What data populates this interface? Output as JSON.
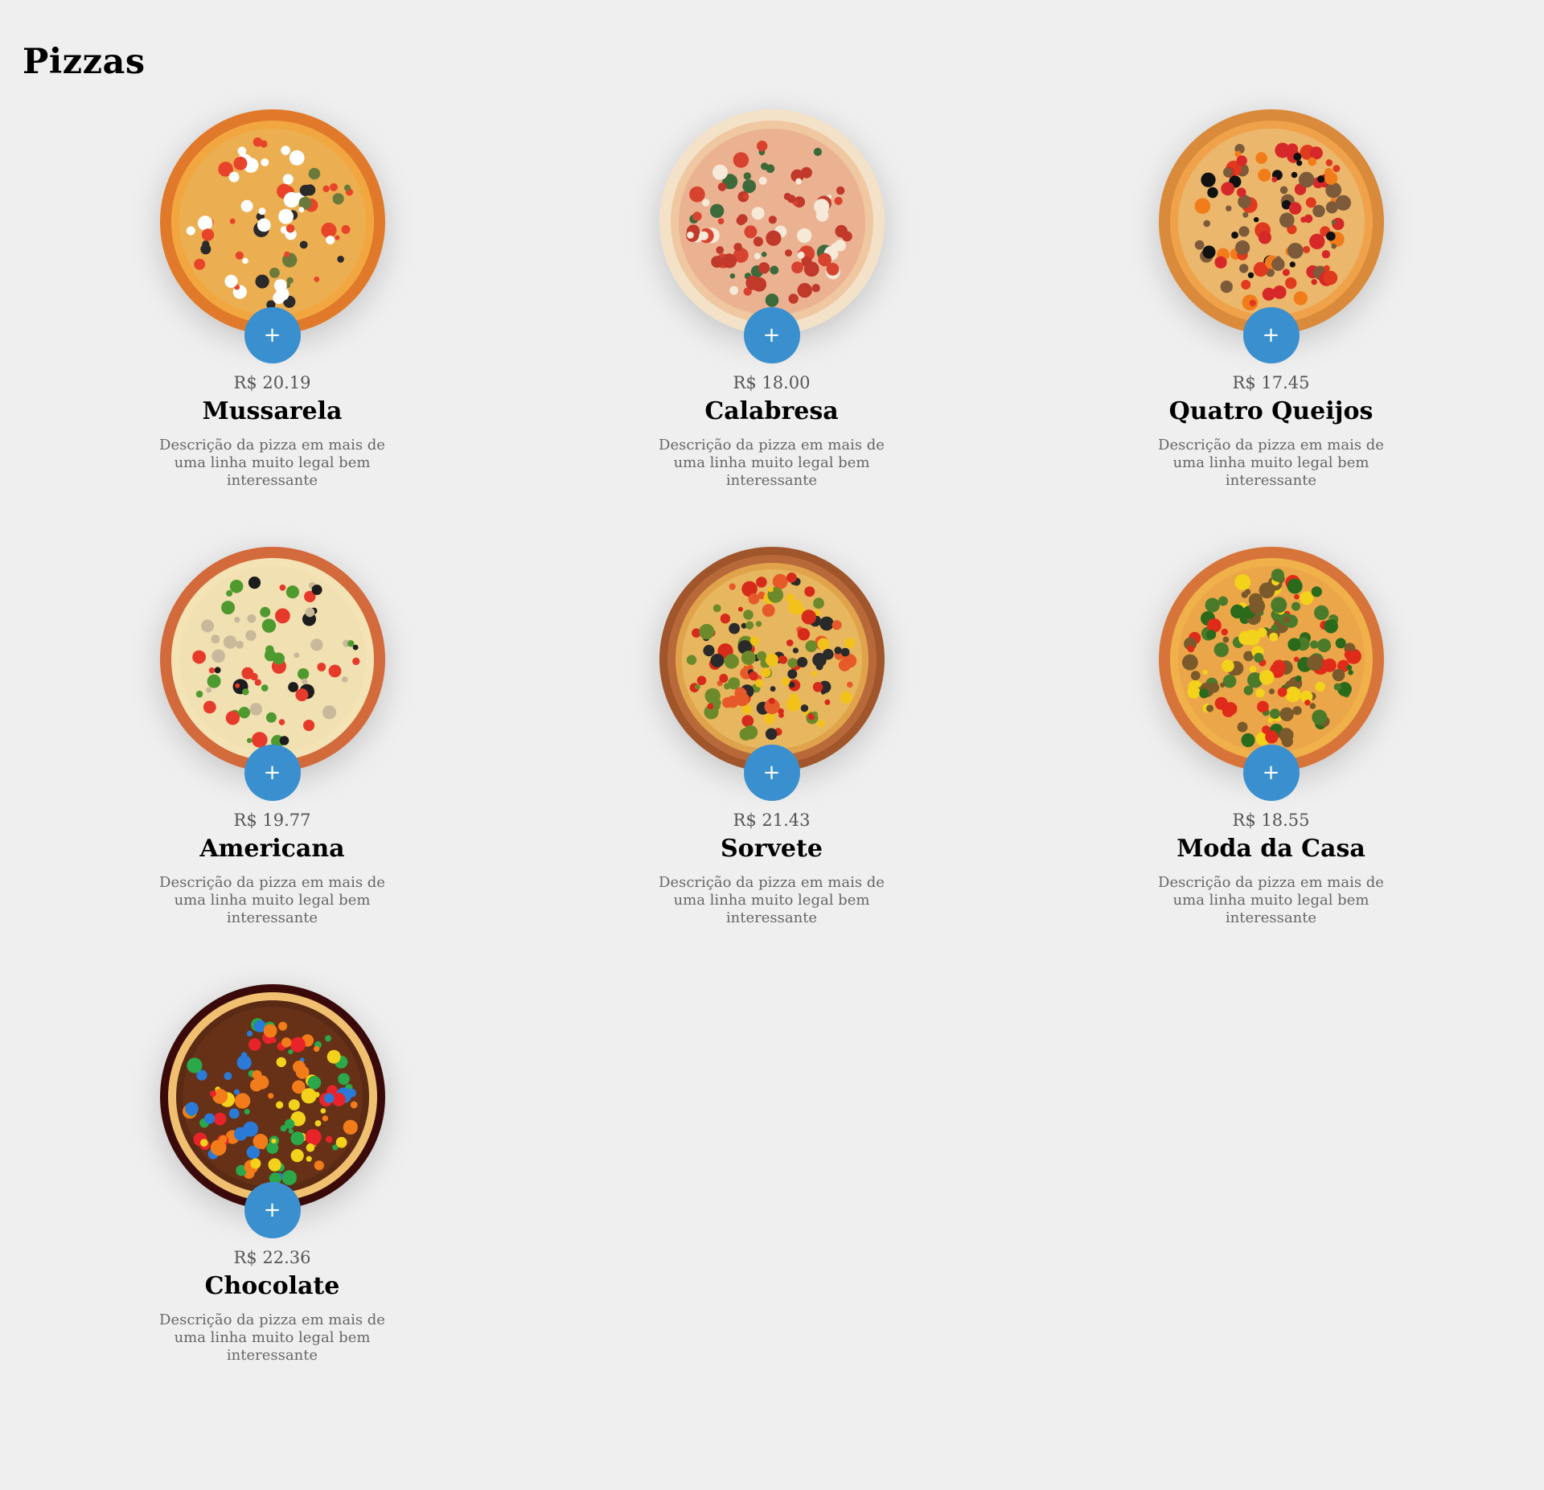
{
  "page": {
    "title": "Pizzas"
  },
  "pizzas": [
    {
      "name": "Mussarela",
      "price": "R$ 20.19",
      "description": "Descrição da pizza em mais de uma linha muito legal bem interessante",
      "add_label": "+",
      "style": "olive-tomato"
    },
    {
      "name": "Calabresa",
      "price": "R$ 18.00",
      "description": "Descrição da pizza em mais de uma linha muito legal bem interessante",
      "add_label": "+",
      "style": "light-cheese"
    },
    {
      "name": "Quatro Queijos",
      "price": "R$ 17.45",
      "description": "Descrição da pizza em mais de uma linha muito legal bem interessante",
      "add_label": "+",
      "style": "tomato-olive-dense"
    },
    {
      "name": "Americana",
      "price": "R$ 19.77",
      "description": "Descrição da pizza em mais de uma linha muito legal bem interessante",
      "add_label": "+",
      "style": "broccoli"
    },
    {
      "name": "Sorvete",
      "price": "R$ 21.43",
      "description": "Descrição da pizza em mais de uma linha muito legal bem interessante",
      "add_label": "+",
      "style": "wooden-board"
    },
    {
      "name": "Moda da Casa",
      "price": "R$ 18.55",
      "description": "Descrição da pizza em mais de uma linha muito legal bem interessante",
      "add_label": "+",
      "style": "basil-peppers"
    },
    {
      "name": "Chocolate",
      "price": "R$ 22.36",
      "description": "Descrição da pizza em mais de uma linha muito legal bem interessante",
      "add_label": "+",
      "style": "chocolate-candy"
    }
  ],
  "colors": {
    "background": "#efefef",
    "accent": "#3a8fcf",
    "title": "#000000",
    "price": "#555555",
    "description": "#666666"
  },
  "icons": {
    "add": "plus-icon"
  }
}
